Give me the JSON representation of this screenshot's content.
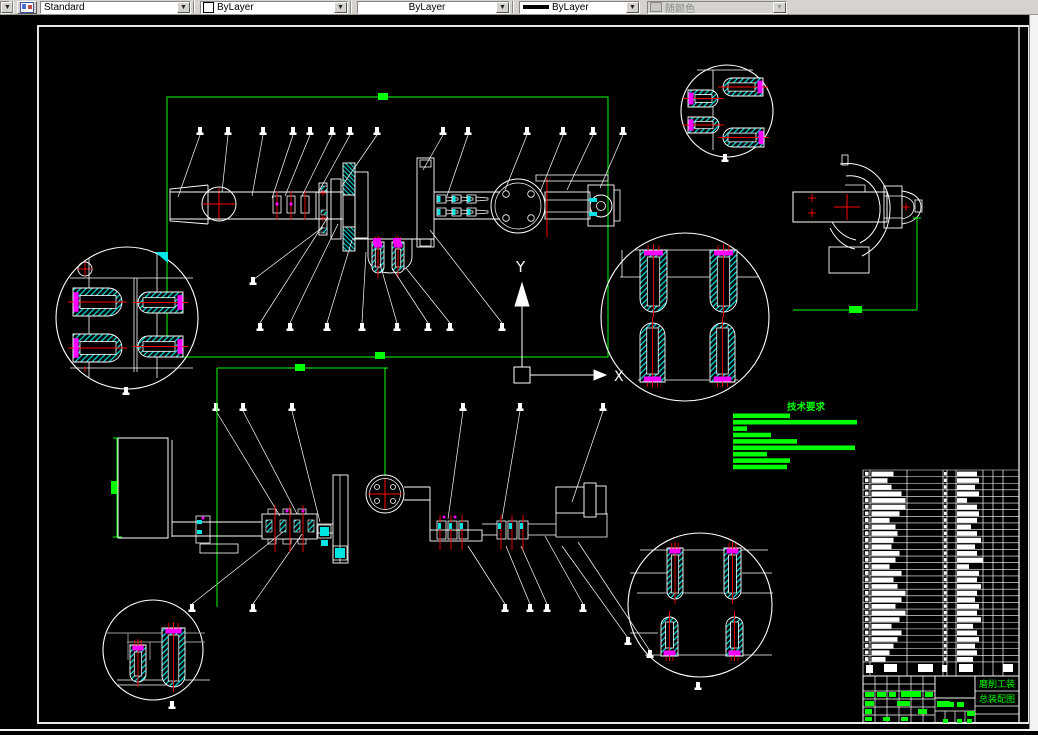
{
  "app": {
    "kind": "CAD drafting application",
    "canvas": "2D technical drawing - grinding fixture assembly"
  },
  "toolbar": {
    "style_combo": "Standard",
    "color_combo": "ByLayer",
    "linetype_combo": "ByLayer",
    "lineweight_combo": "ByLayer",
    "plotstyle_combo": "随颜色"
  },
  "ucs": {
    "x_label": "X",
    "y_label": "Y"
  },
  "tech_requirements": {
    "title": "技术要求",
    "line_widths": [
      57,
      124,
      14,
      38,
      64,
      122,
      34,
      57,
      54
    ]
  },
  "title_block": {
    "project_text": "磨削工装",
    "drawing_text": "总装配图",
    "green_cells": [
      [
        865,
        692,
        9,
        5
      ],
      [
        877,
        692,
        9,
        5
      ],
      [
        889,
        692,
        7,
        5
      ],
      [
        901,
        691,
        20,
        6
      ],
      [
        925,
        692,
        8,
        5
      ],
      [
        865,
        701,
        9,
        5
      ],
      [
        897,
        701,
        13,
        5
      ],
      [
        865,
        709,
        7,
        5
      ],
      [
        918,
        709,
        9,
        5
      ],
      [
        865,
        717,
        7,
        4
      ],
      [
        883,
        717,
        7,
        4
      ],
      [
        901,
        717,
        7,
        4
      ],
      [
        937,
        701,
        13,
        6
      ],
      [
        947,
        702,
        7,
        5
      ],
      [
        957,
        702,
        7,
        5
      ],
      [
        943,
        719,
        5,
        4
      ],
      [
        957,
        719,
        5,
        4
      ],
      [
        967,
        719,
        5,
        4
      ],
      [
        967,
        711,
        8,
        5
      ]
    ]
  },
  "bom": {
    "row_count": 29,
    "name_widths": [
      22,
      16,
      20,
      30,
      34,
      34,
      28,
      18,
      24,
      26,
      22,
      20,
      28,
      24,
      18,
      30,
      22,
      26,
      34,
      30,
      24,
      34,
      28,
      20,
      30,
      26,
      22,
      18,
      14
    ],
    "mat_widths": [
      20,
      22,
      18,
      22,
      10,
      20,
      22,
      20,
      14,
      20,
      24,
      18,
      20,
      26,
      12,
      22,
      20,
      24,
      20,
      18,
      22,
      20,
      24,
      16,
      20,
      22,
      18,
      20,
      16
    ],
    "header_blobs": [
      [
        866,
        665,
        7,
        8
      ],
      [
        884,
        664,
        13,
        8
      ],
      [
        918,
        664,
        15,
        8
      ],
      [
        942,
        665,
        5,
        7
      ],
      [
        959,
        664,
        14,
        8
      ],
      [
        1003,
        664,
        10,
        8
      ]
    ]
  },
  "colors": {
    "background": "#000000",
    "line_white": "#ffffff",
    "dim_green": "#00ff00",
    "hatch_cyan": "#00e4e4",
    "center_red": "#ff0000",
    "head_magenta": "#ff00ff",
    "gray_line": "#9a9a9a",
    "toolbar_bg": "#d6d3ce"
  }
}
